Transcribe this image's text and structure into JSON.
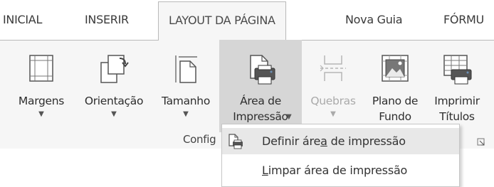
{
  "tabs": [
    {
      "label": "INICIAL",
      "active": false
    },
    {
      "label": "INSERIR",
      "active": false
    },
    {
      "label": "LAYOUT DA PÁGINA",
      "active": true
    },
    {
      "label": "Nova Guia",
      "active": false
    },
    {
      "label": "FÓRMU",
      "active": false
    }
  ],
  "commands": [
    {
      "label": "Margens",
      "icon": "margins-icon",
      "has_dropdown": true
    },
    {
      "label": "Orientação",
      "icon": "orientation-icon",
      "has_dropdown": true
    },
    {
      "label": "Tamanho",
      "icon": "size-icon",
      "has_dropdown": true
    },
    {
      "label": "Área de\nImpressão",
      "icon": "print-area-icon",
      "has_dropdown": true,
      "selected": true
    },
    {
      "label": "Quebras",
      "icon": "breaks-icon",
      "has_dropdown": true,
      "disabled": true
    },
    {
      "label": "Plano de\nFundo",
      "icon": "background-icon",
      "has_dropdown": false
    },
    {
      "label": "Imprimir\nTítulos",
      "icon": "print-titles-icon",
      "has_dropdown": false
    }
  ],
  "group_label": "Config",
  "menu": {
    "items": [
      {
        "before": "Definir áre",
        "accel": "a",
        "after": " de impressão",
        "icon": "print-area-icon",
        "hover": true
      },
      {
        "before": "",
        "accel": "L",
        "after": "impar área de impressão",
        "icon": "",
        "hover": false
      }
    ]
  },
  "colors": {
    "ribbon_bg": "#f6f6f6",
    "selected_bg": "#d6d6d6",
    "menu_hover_bg": "#e8e8e8",
    "printer_blue": "#6b8fb5"
  }
}
